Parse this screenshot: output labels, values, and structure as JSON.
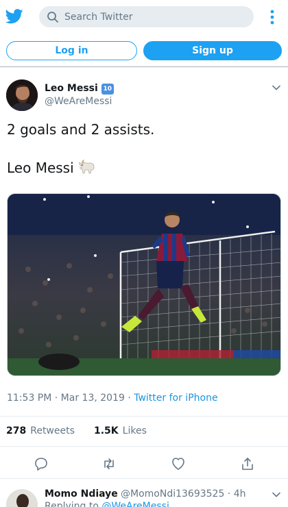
{
  "header": {
    "logo_icon": "twitter-bird-icon",
    "search_placeholder": "Search Twitter",
    "more_icon": "more-vertical-icon",
    "brand_color": "#1da1f2"
  },
  "auth": {
    "login_label": "Log in",
    "signup_label": "Sign up"
  },
  "tweet": {
    "author_name": "Leo Messi",
    "author_badge": "10",
    "author_handle": "@WeAreMessi",
    "line1": "2 goals and 2 assists.",
    "line2": "Leo Messi",
    "goat_icon": "goat-emoji-icon",
    "timestamp": "11:53 PM · Mar 13, 2019 · ",
    "source": "Twitter for iPhone",
    "retweet_count": "278",
    "retweet_label": "Retweets",
    "like_count": "1.5K",
    "like_label": "Likes"
  },
  "actions": {
    "reply_icon": "reply-icon",
    "retweet_icon": "retweet-icon",
    "like_icon": "heart-icon",
    "share_icon": "share-icon"
  },
  "reply": {
    "author_name": "Momo Ndiaye",
    "author_handle": "@MomoNdi13693525 · 4h",
    "replying_to_label": "Replying to ",
    "replying_to_handle": "@WeAreMessi"
  }
}
